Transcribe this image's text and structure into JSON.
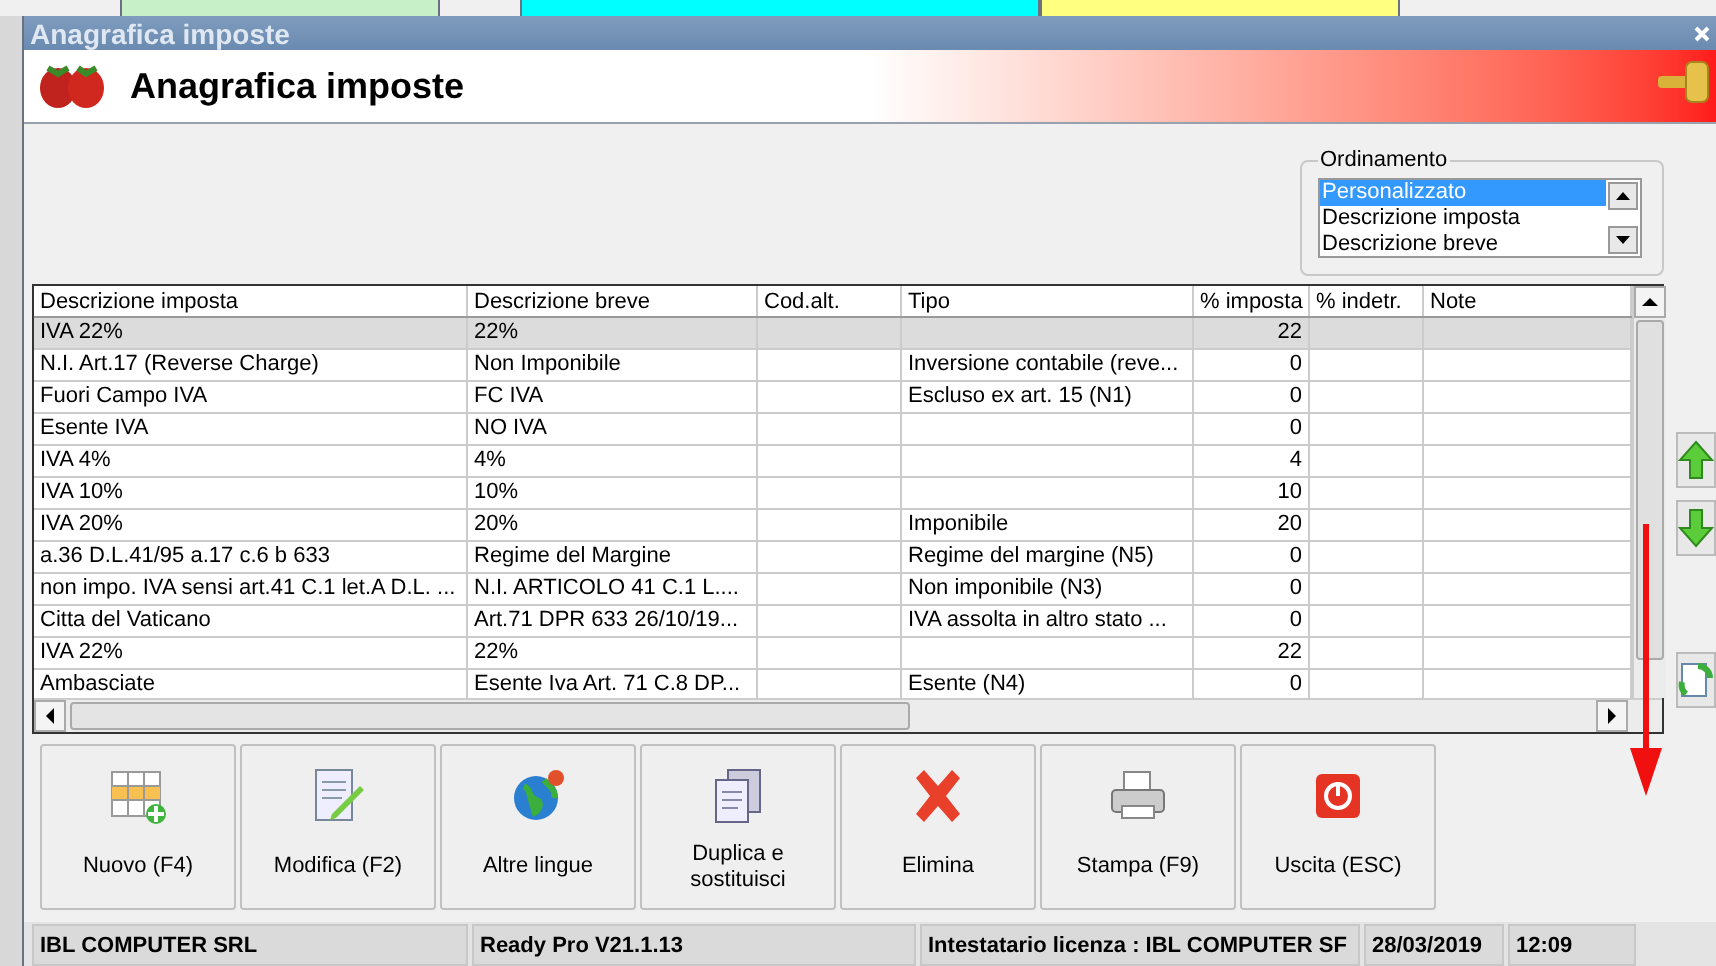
{
  "window": {
    "title": "Anagrafica imposte"
  },
  "header": {
    "title": "Anagrafica imposte"
  },
  "sorting": {
    "label": "Ordinamento",
    "options": [
      {
        "label": "Personalizzato",
        "selected": true
      },
      {
        "label": "Descrizione imposta",
        "selected": false
      },
      {
        "label": "Descrizione breve",
        "selected": false
      }
    ]
  },
  "table": {
    "columns": [
      "Descrizione imposta",
      "Descrizione breve",
      "Cod.alt.",
      "Tipo",
      "% imposta",
      "% indetr.",
      "Note"
    ],
    "rows": [
      {
        "selected": true,
        "cells": [
          "IVA 22%",
          "22%",
          "",
          "",
          "22",
          "",
          ""
        ]
      },
      {
        "selected": false,
        "cells": [
          "N.I. Art.17 (Reverse Charge)",
          "Non Imponibile",
          "",
          "Inversione contabile (reve...",
          "0",
          "",
          ""
        ]
      },
      {
        "selected": false,
        "cells": [
          "Fuori Campo IVA",
          "FC IVA",
          "",
          "Escluso ex art. 15 (N1)",
          "0",
          "",
          ""
        ]
      },
      {
        "selected": false,
        "cells": [
          "Esente IVA",
          "NO IVA",
          "",
          "",
          "0",
          "",
          ""
        ]
      },
      {
        "selected": false,
        "cells": [
          "IVA 4%",
          "4%",
          "",
          "",
          "4",
          "",
          ""
        ]
      },
      {
        "selected": false,
        "cells": [
          "IVA 10%",
          "10%",
          "",
          "",
          "10",
          "",
          ""
        ]
      },
      {
        "selected": false,
        "cells": [
          "IVA 20%",
          "20%",
          "",
          "Imponibile",
          "20",
          "",
          ""
        ]
      },
      {
        "selected": false,
        "cells": [
          "a.36 D.L.41/95 a.17 c.6 b 633",
          "Regime del Margine",
          "",
          "Regime del margine (N5)",
          "0",
          "",
          ""
        ]
      },
      {
        "selected": false,
        "cells": [
          "non impo. IVA sensi art.41 C.1 let.A D.L. ...",
          "N.I. ARTICOLO 41 C.1 L....",
          "",
          "Non imponibile (N3)",
          "0",
          "",
          ""
        ]
      },
      {
        "selected": false,
        "cells": [
          "Citta del Vaticano",
          "Art.71 DPR 633 26/10/19...",
          "",
          "IVA assolta in altro stato ...",
          "0",
          "",
          ""
        ]
      },
      {
        "selected": false,
        "cells": [
          "IVA 22%",
          "22%",
          "",
          "",
          "22",
          "",
          ""
        ]
      },
      {
        "selected": false,
        "cells": [
          "Ambasciate",
          "Esente Iva Art. 71 C.8 DP...",
          "",
          "Esente (N4)",
          "0",
          "",
          ""
        ]
      }
    ]
  },
  "toolbar": [
    {
      "kind": "new",
      "label": "Nuovo (F4)"
    },
    {
      "kind": "edit",
      "label": "Modifica (F2)"
    },
    {
      "kind": "globe",
      "label": "Altre lingue"
    },
    {
      "kind": "duplicate",
      "label": "Duplica e sostituisci"
    },
    {
      "kind": "delete",
      "label": "Elimina"
    },
    {
      "kind": "print",
      "label": "Stampa (F9)"
    },
    {
      "kind": "exit",
      "label": "Uscita (ESC)"
    }
  ],
  "status_bar": [
    "IBL COMPUTER SRL",
    "Ready Pro V21.1.13",
    "Intestatario licenza : IBL COMPUTER SF",
    "28/03/2019",
    "12:09"
  ]
}
